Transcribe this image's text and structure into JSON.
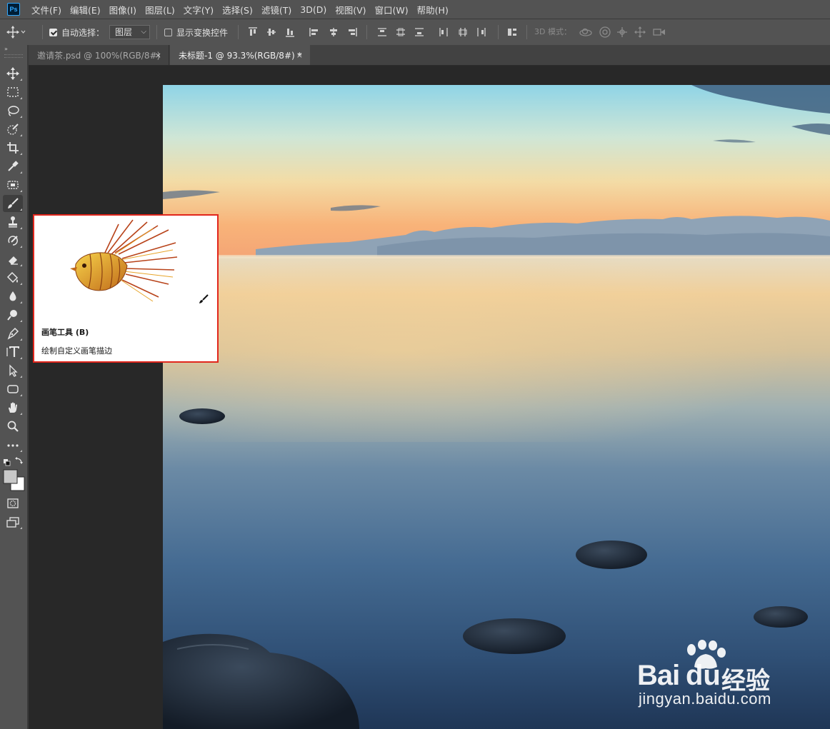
{
  "app": {
    "logo_text": "Ps"
  },
  "menu": [
    "文件(F)",
    "编辑(E)",
    "图像(I)",
    "图层(L)",
    "文字(Y)",
    "选择(S)",
    "滤镜(T)",
    "3D(D)",
    "视图(V)",
    "窗口(W)",
    "帮助(H)"
  ],
  "options": {
    "auto_select_label": "自动选择：",
    "auto_select_checked": true,
    "auto_select_target": "图层",
    "show_transform_label": "显示变换控件",
    "show_transform_checked": false,
    "mode_3d_label": "3D 模式："
  },
  "tabs": [
    {
      "name": "邀请茶.psd @ 100%(RGB/8#)",
      "close": "×",
      "active": false
    },
    {
      "name": "未标题-1 @ 93.3%(RGB/8#) *",
      "close": "×",
      "active": true
    }
  ],
  "toolbar": {
    "collapse_glyph": "»",
    "tools": [
      "move-tool",
      "marquee-tool",
      "lasso-tool",
      "quick-select-tool",
      "crop-tool",
      "eyedropper-tool",
      "healing-tool",
      "brush-tool",
      "stamp-tool",
      "history-brush-tool",
      "eraser-tool",
      "paint-bucket-tool",
      "blur-tool",
      "dodge-tool",
      "pen-tool",
      "type-tool",
      "path-select-tool",
      "shape-tool",
      "hand-tool",
      "zoom-tool",
      "more-tools"
    ],
    "active_tool": "brush-tool",
    "foreground_color": "#c8c8c8",
    "background_color": "#ffffff"
  },
  "tooltip": {
    "title": "画笔工具 (B)",
    "description": "绘制自定义画笔描边",
    "border_color": "#e1261c"
  },
  "watermark": {
    "brand_a": "Bai",
    "brand_b": "du",
    "brand_c": "经验",
    "url": "jingyan.baidu.com"
  }
}
